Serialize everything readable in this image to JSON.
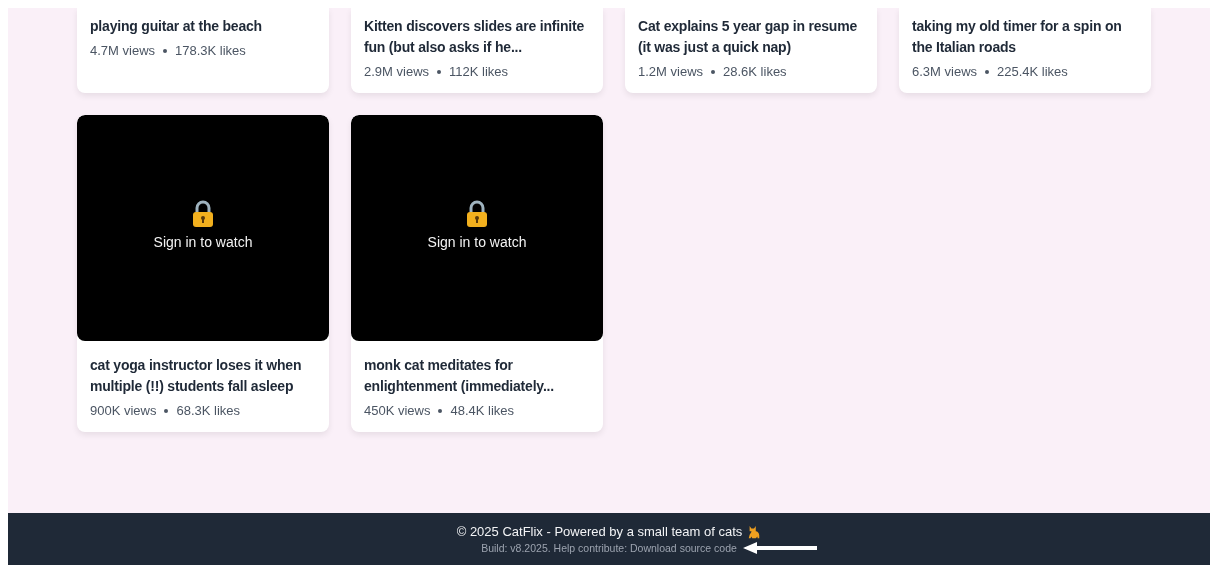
{
  "videos": [
    {
      "title": "playing guitar at the beach",
      "views": "4.7M views",
      "likes": "178.3K likes",
      "locked": false,
      "cut_top": true
    },
    {
      "title": "Kitten discovers slides are infinite fun (but also asks if he...",
      "views": "2.9M views",
      "likes": "112K likes",
      "locked": false,
      "cut_top": true
    },
    {
      "title": "Cat explains 5 year gap in resume (it was just a quick nap)",
      "views": "1.2M views",
      "likes": "28.6K likes",
      "locked": false,
      "cut_top": true
    },
    {
      "title": "taking my old timer for a spin on the Italian roads",
      "views": "6.3M views",
      "likes": "225.4K likes",
      "locked": false,
      "cut_top": true
    },
    {
      "title": "cat yoga instructor loses it when multiple (!!) students fall asleep",
      "views": "900K views",
      "likes": "68.3K likes",
      "locked": true,
      "lock_text": "Sign in to watch",
      "cut_top": false
    },
    {
      "title": "monk cat meditates for enlightenment (immediately...",
      "views": "450K views",
      "likes": "48.4K likes",
      "locked": true,
      "lock_text": "Sign in to watch",
      "cut_top": false
    }
  ],
  "footer": {
    "copyright": "© 2025 CatFlix - Powered by a small team of cats",
    "build": "Build: v8.2025. Help contribute: Download source code"
  }
}
